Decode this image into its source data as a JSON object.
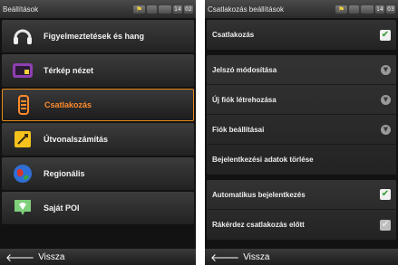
{
  "left_screen": {
    "status_title": "Beállítások",
    "status_chips": [
      "",
      "",
      "",
      "14",
      "02"
    ],
    "menu": [
      {
        "label": "Figyelmeztetések és hang",
        "icon": "headphones-icon",
        "selected": false
      },
      {
        "label": "Térkép nézet",
        "icon": "map-view-icon",
        "selected": false
      },
      {
        "label": "Csatlakozás",
        "icon": "connection-icon",
        "selected": true
      },
      {
        "label": "Útvonalszámítás",
        "icon": "route-calc-icon",
        "selected": false
      },
      {
        "label": "Regionális",
        "icon": "globe-icon",
        "selected": false
      },
      {
        "label": "Saját POI",
        "icon": "poi-icon",
        "selected": false
      }
    ],
    "back_label": "Vissza"
  },
  "right_screen": {
    "status_title": "Csatlakozás beállítások",
    "status_chips": [
      "",
      "",
      "",
      "14",
      "03"
    ],
    "group1": [
      {
        "label": "Csatlakozás",
        "control": "checkbox",
        "checked": true
      }
    ],
    "group2": [
      {
        "label": "Jelszó módosítása",
        "control": "chevron"
      },
      {
        "label": "Új fiók létrehozása",
        "control": "chevron"
      },
      {
        "label": "Fiók beállításai",
        "control": "chevron"
      },
      {
        "label": "Bejelentkezési adatok törlése",
        "control": "none"
      }
    ],
    "group3": [
      {
        "label": "Automatikus bejelentkezés",
        "control": "checkbox",
        "checked": true
      },
      {
        "label": "Rákérdez csatlakozás előtt",
        "control": "checkbox",
        "checked": false
      }
    ],
    "back_label": "Vissza"
  },
  "colors": {
    "accent_orange": "#ff8a2a",
    "check_green": "#2a9a2a"
  }
}
